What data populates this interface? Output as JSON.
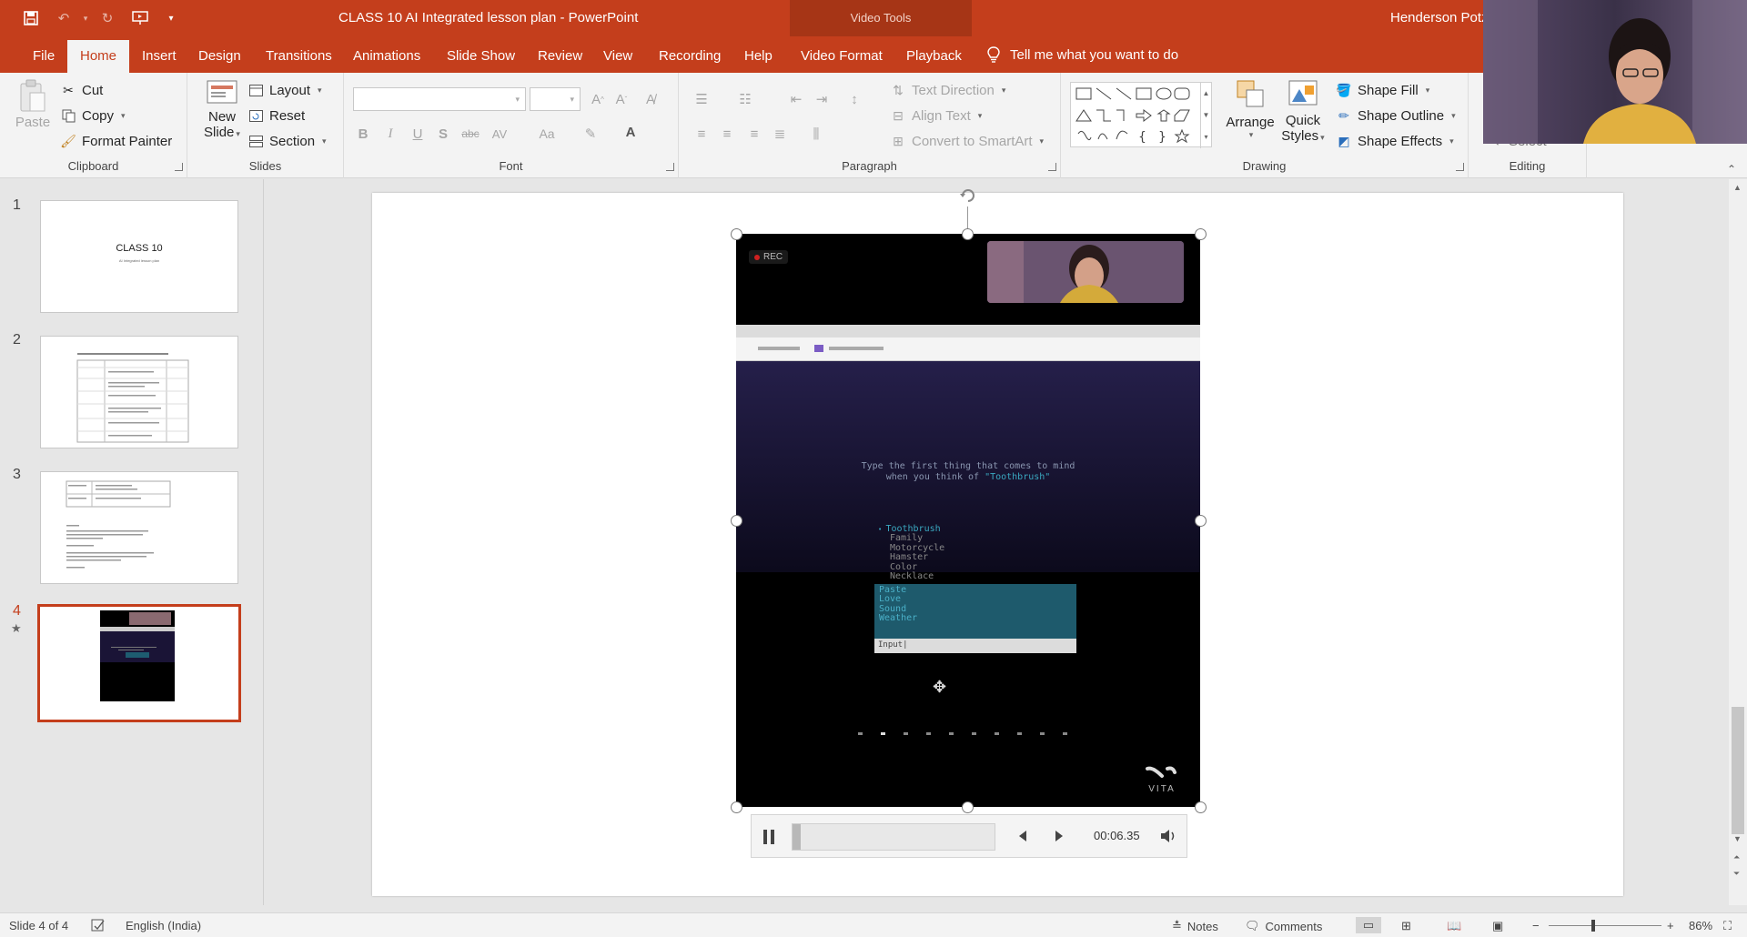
{
  "window": {
    "title": "CLASS 10 AI Integrated lesson plan  -  PowerPoint",
    "contextual_label": "Video Tools",
    "user": "Henderson Potz"
  },
  "tabs": [
    "File",
    "Home",
    "Insert",
    "Design",
    "Transitions",
    "Animations",
    "Slide Show",
    "Review",
    "View",
    "Recording",
    "Help",
    "Video Format",
    "Playback"
  ],
  "active_tab": "Home",
  "tell_me": "Tell me what you want to do",
  "ribbon": {
    "clipboard": {
      "paste": "Paste",
      "cut": "Cut",
      "copy": "Copy",
      "format_painter": "Format Painter",
      "label": "Clipboard"
    },
    "slides": {
      "new_slide_1": "New",
      "new_slide_2": "Slide",
      "layout": "Layout",
      "reset": "Reset",
      "section": "Section",
      "label": "Slides"
    },
    "font": {
      "bold": "B",
      "italic": "I",
      "underline": "U",
      "shadow": "S",
      "strike": "abc",
      "spacing": "AV",
      "case": "Aa",
      "label": "Font"
    },
    "paragraph": {
      "text_direction": "Text Direction",
      "align_text": "Align Text",
      "convert_smartart": "Convert to SmartArt",
      "label": "Paragraph"
    },
    "drawing": {
      "arrange": "Arrange",
      "quick_styles_1": "Quick",
      "quick_styles_2": "Styles",
      "shape_fill": "Shape Fill",
      "shape_outline": "Shape Outline",
      "shape_effects": "Shape Effects",
      "label": "Drawing"
    },
    "editing": {
      "select": "Select",
      "label": "Editing"
    }
  },
  "thumbnails": [
    {
      "num": "1",
      "title": "CLASS 10",
      "subtitle": "AI Integrated lesson plan"
    },
    {
      "num": "2"
    },
    {
      "num": "3"
    },
    {
      "num": "4"
    }
  ],
  "video": {
    "rec": "REC",
    "prompt_line1": "Type the first thing that comes to mind",
    "prompt_line2_a": "when you think of ",
    "prompt_line2_b": "\"Toothbrush\"",
    "words_main": [
      "Toothbrush",
      "Family",
      "Motorcycle",
      "Hamster",
      "Color",
      "Necklace"
    ],
    "words_box": [
      "Paste",
      "Love",
      "Sound",
      "Weather"
    ],
    "input_text": "Input|",
    "brand": "VITA",
    "progress": 0.04,
    "time": "00:06.35"
  },
  "status": {
    "slide": "Slide 4 of 4",
    "language": "English (India)",
    "notes": "Notes",
    "comments": "Comments",
    "zoom": "86%"
  }
}
